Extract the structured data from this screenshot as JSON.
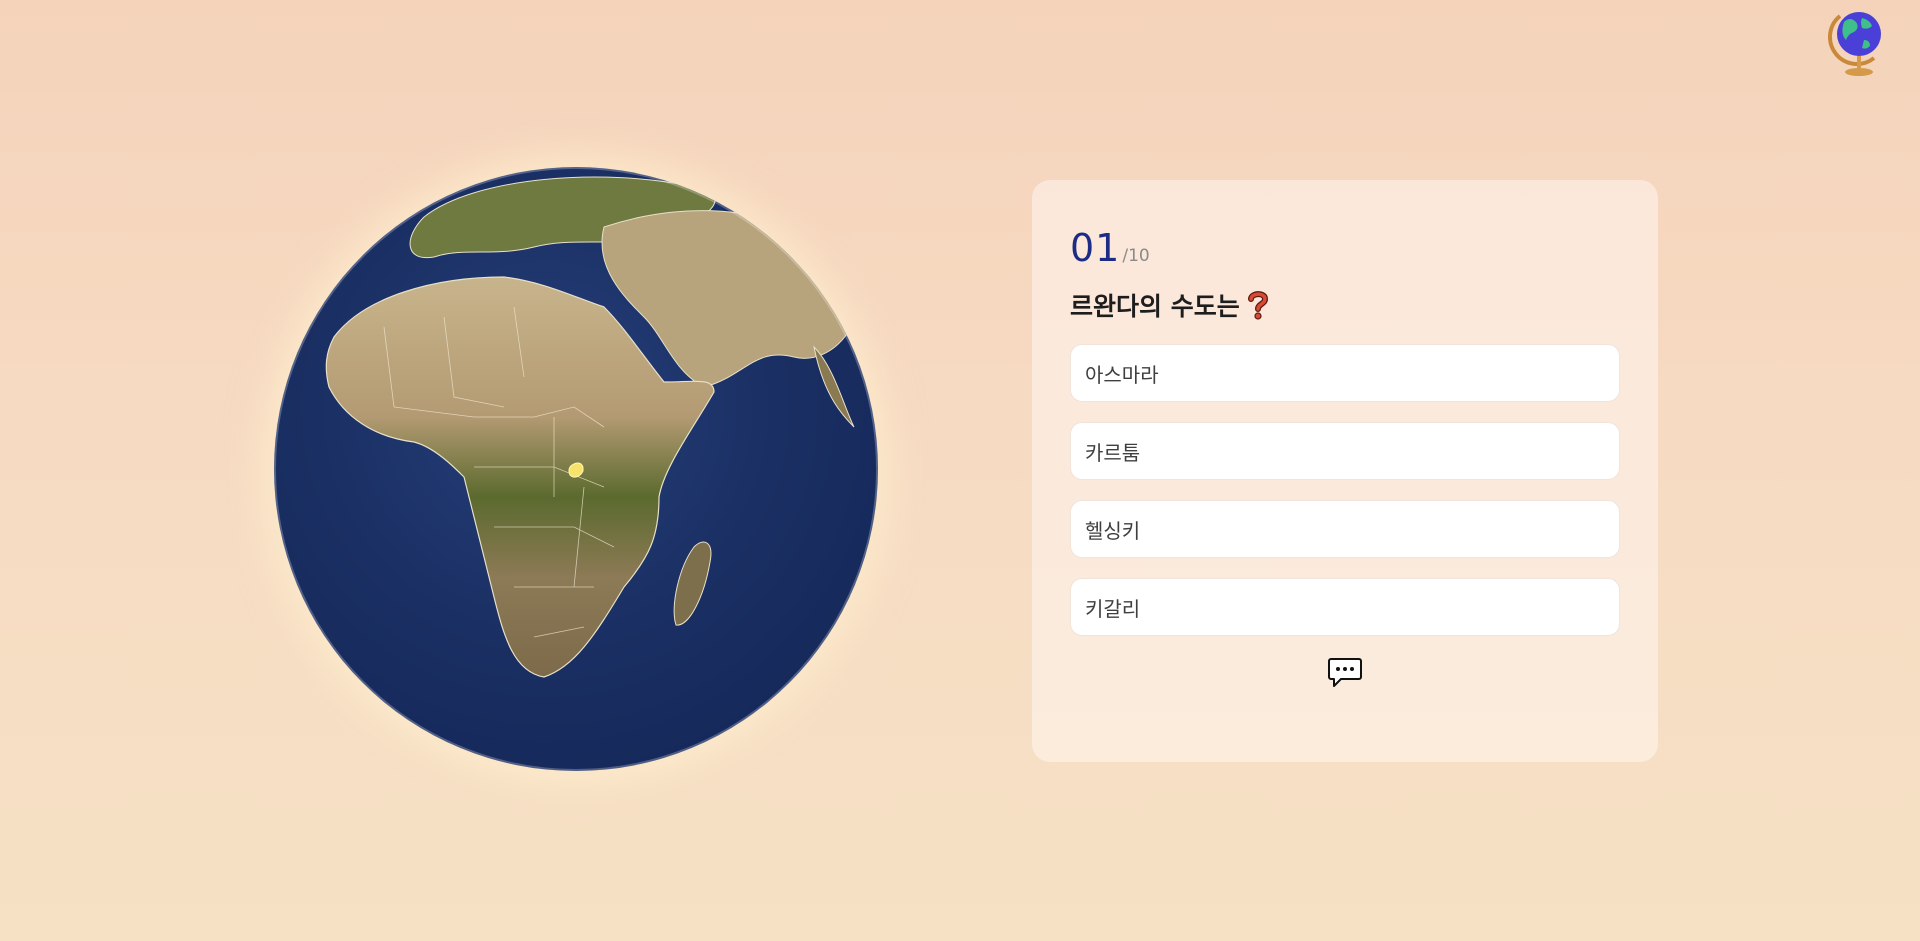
{
  "header": {
    "logo_icon": "globe-on-stand-icon"
  },
  "globe": {
    "view": "Africa",
    "highlighted_country": "Rwanda",
    "highlight_color": "#f7e36b",
    "ocean_color": "#1a2f63"
  },
  "quiz": {
    "current": "01",
    "total": "/10",
    "question": "르완다의 수도는",
    "question_icon": "red-question-mark-icon",
    "options": [
      {
        "label": "아스마라"
      },
      {
        "label": "카르툼"
      },
      {
        "label": "헬싱키"
      },
      {
        "label": "키갈리"
      }
    ],
    "hint_icon": "speech-bubble-icon"
  },
  "colors": {
    "accent": "#1c2c86",
    "background_top": "#f5d3bb",
    "background_bottom": "#f6e1c4"
  }
}
